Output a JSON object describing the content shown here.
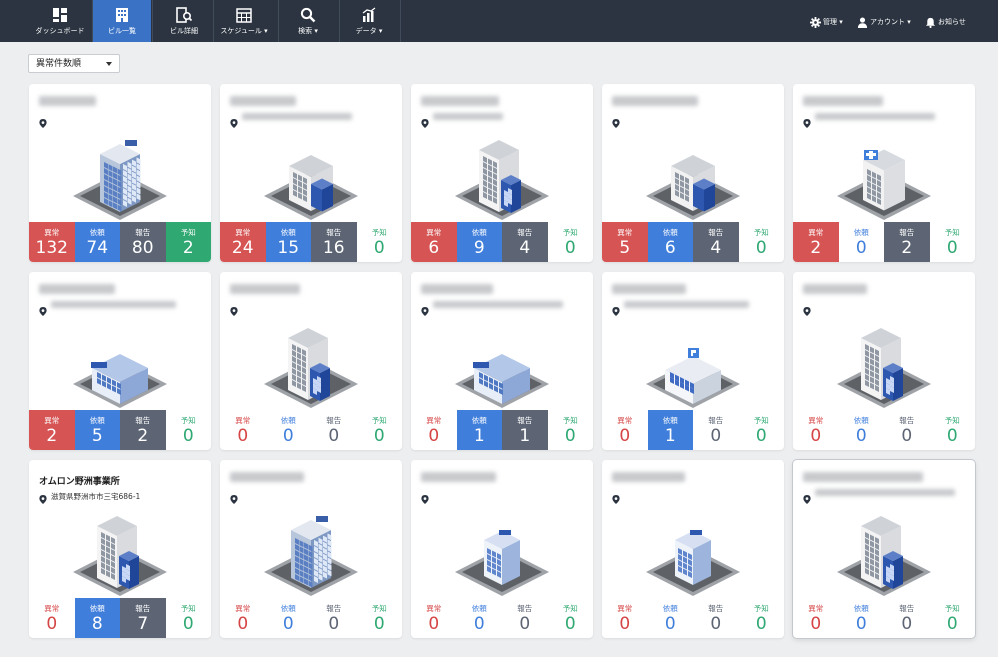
{
  "nav": {
    "items": [
      {
        "label": "ダッシュボード",
        "icon": "dashboard-icon",
        "active": false
      },
      {
        "label": "ビル一覧",
        "icon": "building-list-icon",
        "active": true
      },
      {
        "label": "ビル詳細",
        "icon": "building-detail-icon",
        "active": false
      },
      {
        "label": "スケジュール ▾",
        "icon": "calendar-icon",
        "active": false
      },
      {
        "label": "検索 ▾",
        "icon": "search-icon",
        "active": false
      },
      {
        "label": "データ ▾",
        "icon": "data-chart-icon",
        "active": false
      }
    ],
    "right": [
      {
        "label": "管理 ▾",
        "icon": "gear-icon"
      },
      {
        "label": "アカウント ▾",
        "icon": "user-icon"
      },
      {
        "label": "お知らせ",
        "icon": "bell-icon"
      }
    ]
  },
  "sort": {
    "selected": "異常件数順"
  },
  "stat_labels": [
    "異常",
    "依頼",
    "報告",
    "予知"
  ],
  "colors": {
    "red": "#d65454",
    "blue": "#3f7edb",
    "gray": "#5d6574",
    "green": "#2fa872",
    "nav_bg": "#2b3440",
    "nav_active": "#3a73c6"
  },
  "buildings": [
    {
      "name": "",
      "address": "",
      "type": "round-tower",
      "values": [
        132,
        74,
        80,
        2
      ]
    },
    {
      "name": "",
      "address": "",
      "type": "office-small",
      "values": [
        24,
        15,
        16,
        0
      ]
    },
    {
      "name": "",
      "address": "",
      "type": "office-tall",
      "values": [
        6,
        9,
        4,
        0
      ]
    },
    {
      "name": "",
      "address": "",
      "type": "office-small",
      "values": [
        5,
        6,
        4,
        0
      ]
    },
    {
      "name": "",
      "address": "",
      "type": "hospital",
      "values": [
        2,
        0,
        2,
        0
      ]
    },
    {
      "name": "",
      "address": "",
      "type": "mall",
      "values": [
        2,
        5,
        2,
        0
      ]
    },
    {
      "name": "",
      "address": "",
      "type": "office-tall",
      "values": [
        0,
        0,
        0,
        0
      ]
    },
    {
      "name": "",
      "address": "",
      "type": "mall",
      "values": [
        0,
        1,
        1,
        0
      ]
    },
    {
      "name": "",
      "address": "",
      "type": "parking",
      "values": [
        0,
        1,
        0,
        0
      ]
    },
    {
      "name": "",
      "address": "",
      "type": "office-tall",
      "values": [
        0,
        0,
        0,
        0
      ]
    },
    {
      "name": "オムロン野洲事業所",
      "address": "滋賀県野洲市市三宅686-1",
      "type": "office-tall",
      "values": [
        0,
        8,
        7,
        0
      ]
    },
    {
      "name": "",
      "address": "",
      "type": "round-tower",
      "values": [
        0,
        0,
        0,
        0
      ]
    },
    {
      "name": "",
      "address": "",
      "type": "hotel",
      "values": [
        0,
        0,
        0,
        0
      ]
    },
    {
      "name": "",
      "address": "",
      "type": "hotel",
      "values": [
        0,
        0,
        0,
        0
      ]
    },
    {
      "name": "",
      "address": "",
      "type": "office-tall",
      "values": [
        0,
        0,
        0,
        0
      ]
    }
  ]
}
